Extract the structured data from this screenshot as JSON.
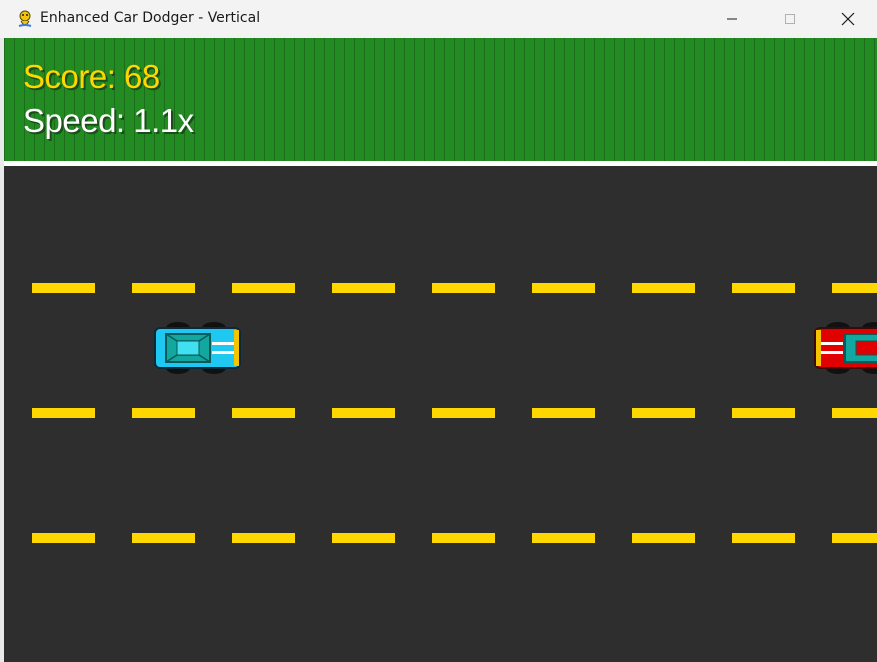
{
  "window": {
    "title": "Enhanced Car Dodger - Vertical",
    "icon": "pygame-snake-icon",
    "controls": [
      "minimize-icon",
      "maximize-icon",
      "close-icon"
    ]
  },
  "hud": {
    "score_text": "Score: 68",
    "speed_text": "Speed: 1.1x"
  },
  "colors": {
    "grass": "#228b22",
    "road": "#2e2e2e",
    "lane_dash": "#ffd700",
    "score": "#ffd700",
    "speed": "#ffffff",
    "player_car": "#1ec8f0",
    "enemy_car": "#e00000"
  },
  "road": {
    "lane_lines": 3,
    "dashes_per_line": 9
  },
  "cars": [
    {
      "role": "player",
      "body_color": "#1ec8f0",
      "roof_color": "#12a8a0",
      "facing": "right"
    },
    {
      "role": "enemy",
      "body_color": "#e00000",
      "roof_color": "#12a8a0",
      "facing": "left"
    }
  ]
}
